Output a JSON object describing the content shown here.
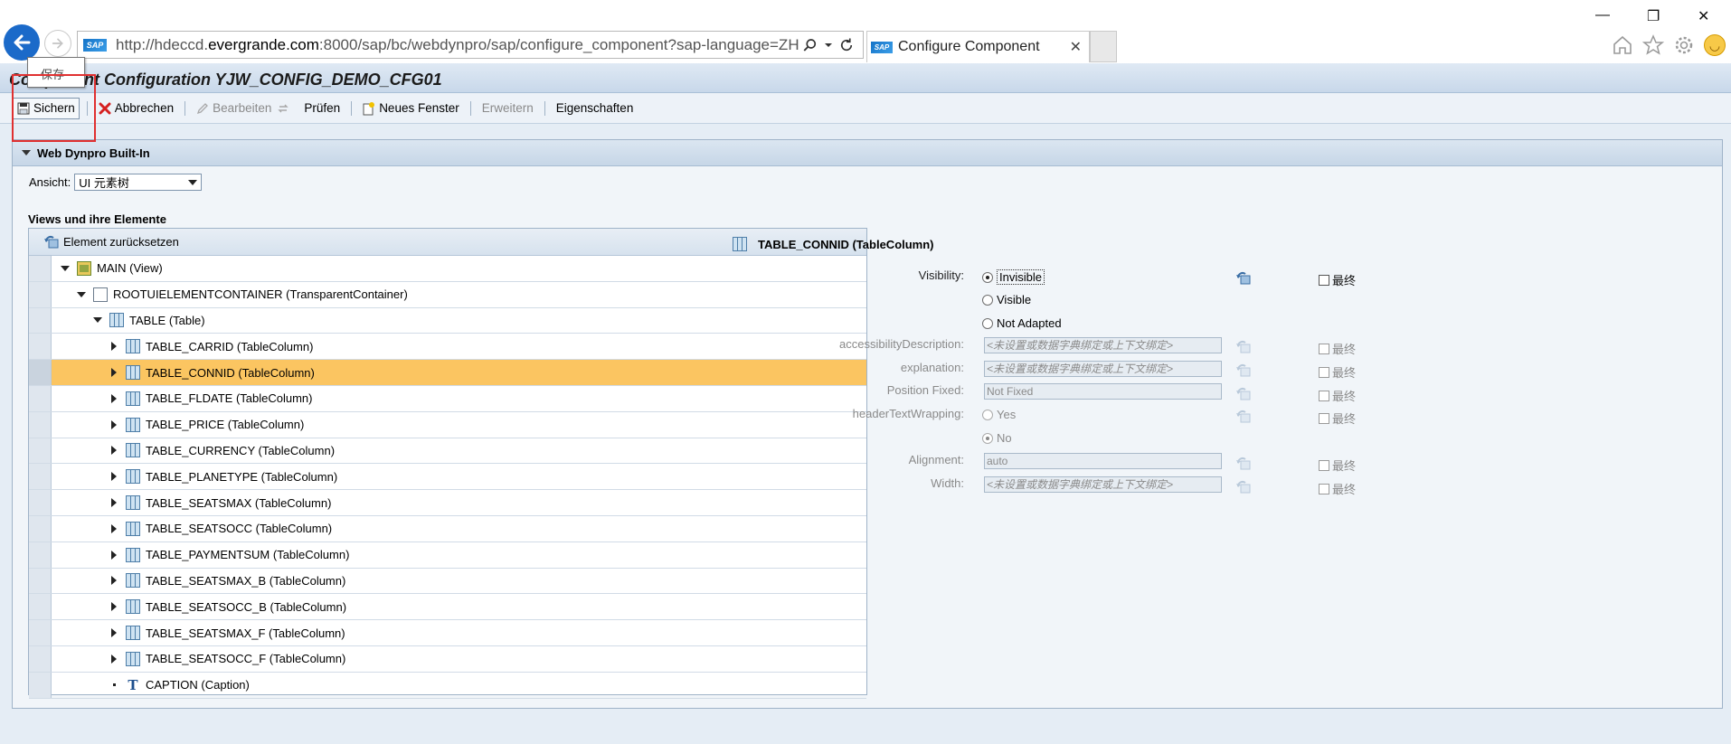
{
  "browser": {
    "url_prefix": "http://hdeccd.",
    "url_domain": "evergrande.com",
    "url_rest": ":8000/sap/bc/webdynpro/sap/configure_component?sap-language=ZH&",
    "tab_title": "Configure Component",
    "sap_logo": "SAP"
  },
  "tooltip": "保存",
  "page": {
    "title": "Component Configuration YJW_CONFIG_DEMO_CFG01"
  },
  "toolbar": {
    "save": "Sichern",
    "cancel": "Abbrechen",
    "edit": "Bearbeiten",
    "check": "Prüfen",
    "new_window": "Neues Fenster",
    "extend": "Erweitern",
    "properties": "Eigenschaften"
  },
  "panel": {
    "title": "Web Dynpro Built-In",
    "view_label": "Ansicht:",
    "view_value": "UI 元素树",
    "views_title": "Views und ihre Elemente",
    "reset_element": "Element zurücksetzen"
  },
  "tree": [
    {
      "label": "MAIN (View)",
      "level": 0,
      "exp": "down",
      "icon": "view-icon",
      "selected": false
    },
    {
      "label": "ROOTUIELEMENTCONTAINER (TransparentContainer)",
      "level": 1,
      "exp": "down",
      "icon": "container-icon",
      "selected": false
    },
    {
      "label": "TABLE (Table)",
      "level": 2,
      "exp": "down",
      "icon": "table-icon",
      "selected": false
    },
    {
      "label": "TABLE_CARRID (TableColumn)",
      "level": 3,
      "exp": "right",
      "icon": "table-column-icon",
      "selected": false
    },
    {
      "label": "TABLE_CONNID (TableColumn)",
      "level": 3,
      "exp": "right",
      "icon": "table-column-icon",
      "selected": true
    },
    {
      "label": "TABLE_FLDATE (TableColumn)",
      "level": 3,
      "exp": "right",
      "icon": "table-column-icon",
      "selected": false
    },
    {
      "label": "TABLE_PRICE (TableColumn)",
      "level": 3,
      "exp": "right",
      "icon": "table-column-icon",
      "selected": false
    },
    {
      "label": "TABLE_CURRENCY (TableColumn)",
      "level": 3,
      "exp": "right",
      "icon": "table-column-icon",
      "selected": false
    },
    {
      "label": "TABLE_PLANETYPE (TableColumn)",
      "level": 3,
      "exp": "right",
      "icon": "table-column-icon",
      "selected": false
    },
    {
      "label": "TABLE_SEATSMAX (TableColumn)",
      "level": 3,
      "exp": "right",
      "icon": "table-column-icon",
      "selected": false
    },
    {
      "label": "TABLE_SEATSOCC (TableColumn)",
      "level": 3,
      "exp": "right",
      "icon": "table-column-icon",
      "selected": false
    },
    {
      "label": "TABLE_PAYMENTSUM (TableColumn)",
      "level": 3,
      "exp": "right",
      "icon": "table-column-icon",
      "selected": false
    },
    {
      "label": "TABLE_SEATSMAX_B (TableColumn)",
      "level": 3,
      "exp": "right",
      "icon": "table-column-icon",
      "selected": false
    },
    {
      "label": "TABLE_SEATSOCC_B (TableColumn)",
      "level": 3,
      "exp": "right",
      "icon": "table-column-icon",
      "selected": false
    },
    {
      "label": "TABLE_SEATSMAX_F (TableColumn)",
      "level": 3,
      "exp": "right",
      "icon": "table-column-icon",
      "selected": false
    },
    {
      "label": "TABLE_SEATSOCC_F (TableColumn)",
      "level": 3,
      "exp": "right",
      "icon": "table-column-icon",
      "selected": false
    },
    {
      "label": "CAPTION (Caption)",
      "level": 3,
      "exp": "dot",
      "icon": "caption-icon",
      "selected": false
    }
  ],
  "detail": {
    "title": "TABLE_CONNID (TableColumn)",
    "visibility_label": "Visibility:",
    "visibility_options": [
      "Invisible",
      "Visible",
      "Not Adapted"
    ],
    "visibility_selected": "Invisible",
    "accessibility_label": "accessibilityDescription:",
    "accessibility_value": "<未设置或数据字典绑定或上下文绑定>",
    "explanation_label": "explanation:",
    "explanation_value": "<未设置或数据字典绑定或上下文绑定>",
    "position_label": "Position Fixed:",
    "position_value": "Not Fixed",
    "header_wrap_label": "headerTextWrapping:",
    "header_wrap_options": [
      "Yes",
      "No"
    ],
    "header_wrap_selected": "No",
    "alignment_label": "Alignment:",
    "alignment_value": "auto",
    "width_label": "Width:",
    "width_value": "<未设置或数据字典绑定或上下文绑定>",
    "final_label": "最终"
  }
}
